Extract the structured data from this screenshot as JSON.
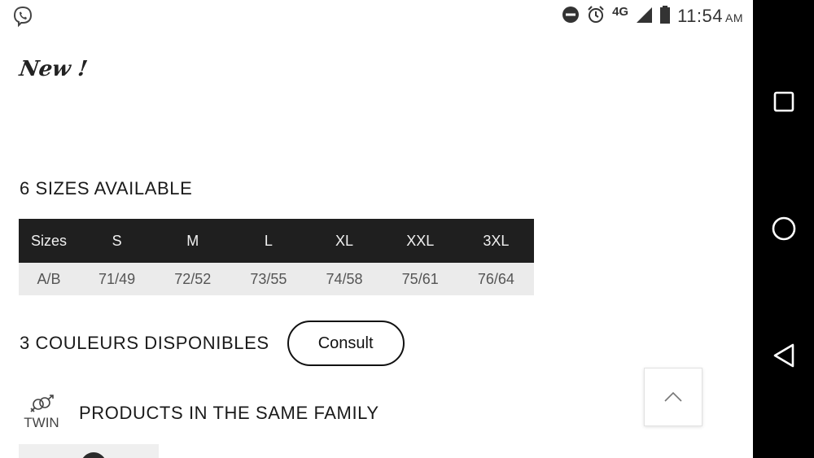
{
  "status_bar": {
    "network": "4G",
    "time": "11:54",
    "ampm": "AM"
  },
  "badge": {
    "text": "New !"
  },
  "sizes": {
    "title": "6 SIZES AVAILABLE",
    "headers": [
      "Sizes",
      "S",
      "M",
      "L",
      "XL",
      "XXL",
      "3XL"
    ],
    "rows": [
      [
        "A/B",
        "71/49",
        "72/52",
        "73/55",
        "74/58",
        "75/61",
        "76/64"
      ]
    ]
  },
  "colors": {
    "title": "3 COULEURS DISPONIBLES",
    "consult_label": "Consult"
  },
  "family": {
    "twin_label": "TWIN",
    "title": "PRODUCTS IN THE SAME FAMILY"
  },
  "icons": {
    "viber": "viber-icon",
    "dnd": "do-not-disturb-icon",
    "alarm": "alarm-icon",
    "signal": "signal-icon",
    "battery": "battery-icon",
    "scroll_top": "chevron-up-icon",
    "nav_recent": "square-icon",
    "nav_home": "circle-icon",
    "nav_back": "triangle-back-icon"
  },
  "colors_palette": {
    "table_header_bg": "#1f1f1f",
    "table_row_bg": "#ebebeb",
    "navbar_bg": "#000000"
  }
}
